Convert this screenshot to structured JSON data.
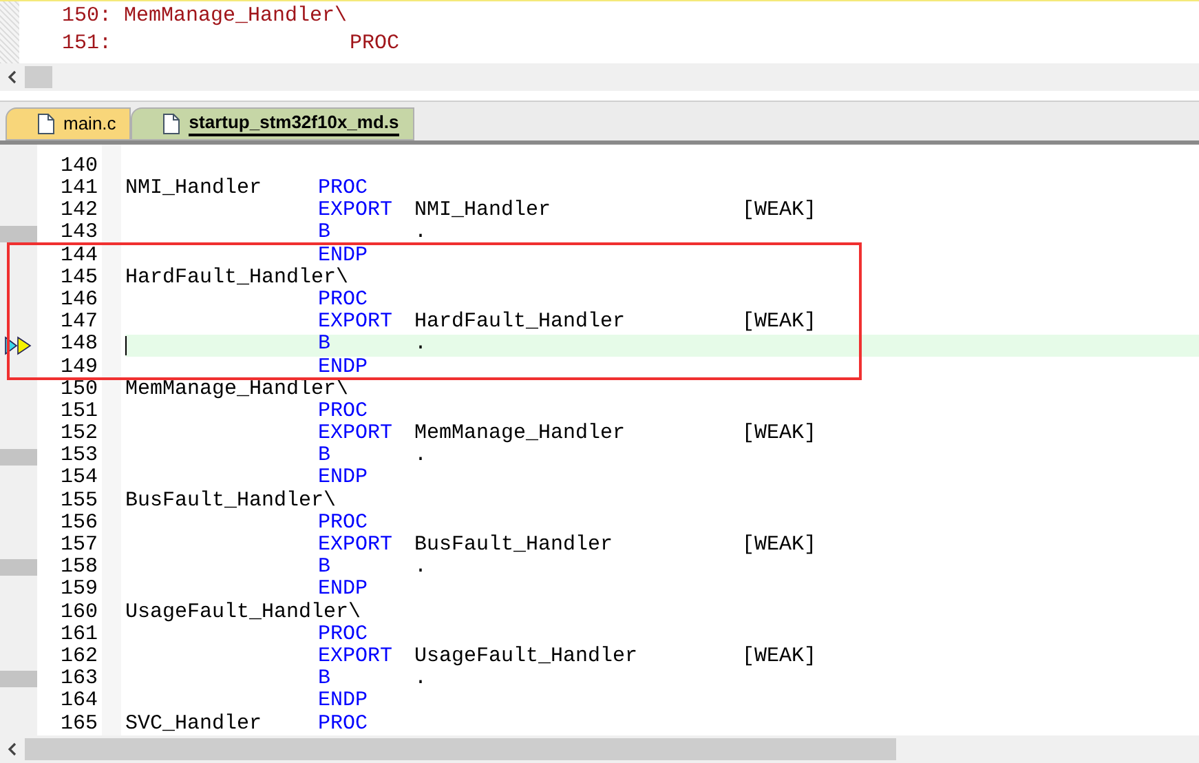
{
  "disassembly": {
    "lines": [
      {
        "address": "150:",
        "label": "MemManage_Handler\\"
      },
      {
        "address": "151:",
        "instr": "PROC"
      }
    ]
  },
  "tabs": [
    {
      "label": "main.c",
      "selected": false,
      "color": "#f8d67a"
    },
    {
      "label": "startup_stm32f10x_md.s",
      "selected": true,
      "color": "#c6d6a6"
    }
  ],
  "editor": {
    "rows": [
      {
        "number": "140",
        "marker": false,
        "current": false
      },
      {
        "number": "141",
        "label": "NMI_Handler",
        "instr": "PROC",
        "marker": false,
        "current": false
      },
      {
        "number": "142",
        "instr": "EXPORT",
        "operand": "NMI_Handler",
        "attr": "[WEAK]",
        "marker": false,
        "current": false
      },
      {
        "number": "143",
        "instr": "B",
        "operand": ".",
        "marker": true,
        "current": false
      },
      {
        "number": "144",
        "instr": "ENDP",
        "marker": false,
        "current": false
      },
      {
        "number": "145",
        "label": "HardFault_Handler\\",
        "marker": false,
        "current": false
      },
      {
        "number": "146",
        "instr": "PROC",
        "marker": false,
        "current": false
      },
      {
        "number": "147",
        "instr": "EXPORT",
        "operand": "HardFault_Handler",
        "attr": "[WEAK]",
        "marker": false,
        "current": false
      },
      {
        "number": "148",
        "instr": "B",
        "operand": ".",
        "marker": false,
        "current": true
      },
      {
        "number": "149",
        "instr": "ENDP",
        "marker": false,
        "current": false
      },
      {
        "number": "150",
        "label": "MemManage_Handler\\",
        "marker": false,
        "current": false
      },
      {
        "number": "151",
        "instr": "PROC",
        "marker": false,
        "current": false
      },
      {
        "number": "152",
        "instr": "EXPORT",
        "operand": "MemManage_Handler",
        "attr": "[WEAK]",
        "marker": false,
        "current": false
      },
      {
        "number": "153",
        "instr": "B",
        "operand": ".",
        "marker": true,
        "current": false
      },
      {
        "number": "154",
        "instr": "ENDP",
        "marker": false,
        "current": false
      },
      {
        "number": "155",
        "label": "BusFault_Handler\\",
        "marker": false,
        "current": false
      },
      {
        "number": "156",
        "instr": "PROC",
        "marker": false,
        "current": false
      },
      {
        "number": "157",
        "instr": "EXPORT",
        "operand": "BusFault_Handler",
        "attr": "[WEAK]",
        "marker": false,
        "current": false
      },
      {
        "number": "158",
        "instr": "B",
        "operand": ".",
        "marker": true,
        "current": false
      },
      {
        "number": "159",
        "instr": "ENDP",
        "marker": false,
        "current": false
      },
      {
        "number": "160",
        "label": "UsageFault_Handler\\",
        "marker": false,
        "current": false
      },
      {
        "number": "161",
        "instr": "PROC",
        "marker": false,
        "current": false
      },
      {
        "number": "162",
        "instr": "EXPORT",
        "operand": "UsageFault_Handler",
        "attr": "[WEAK]",
        "marker": false,
        "current": false
      },
      {
        "number": "163",
        "instr": "B",
        "operand": ".",
        "marker": true,
        "current": false
      },
      {
        "number": "164",
        "instr": "ENDP",
        "marker": false,
        "current": false
      },
      {
        "number": "165",
        "label": "SVC_Handler",
        "instr": "PROC",
        "marker": false,
        "current": false
      }
    ]
  }
}
